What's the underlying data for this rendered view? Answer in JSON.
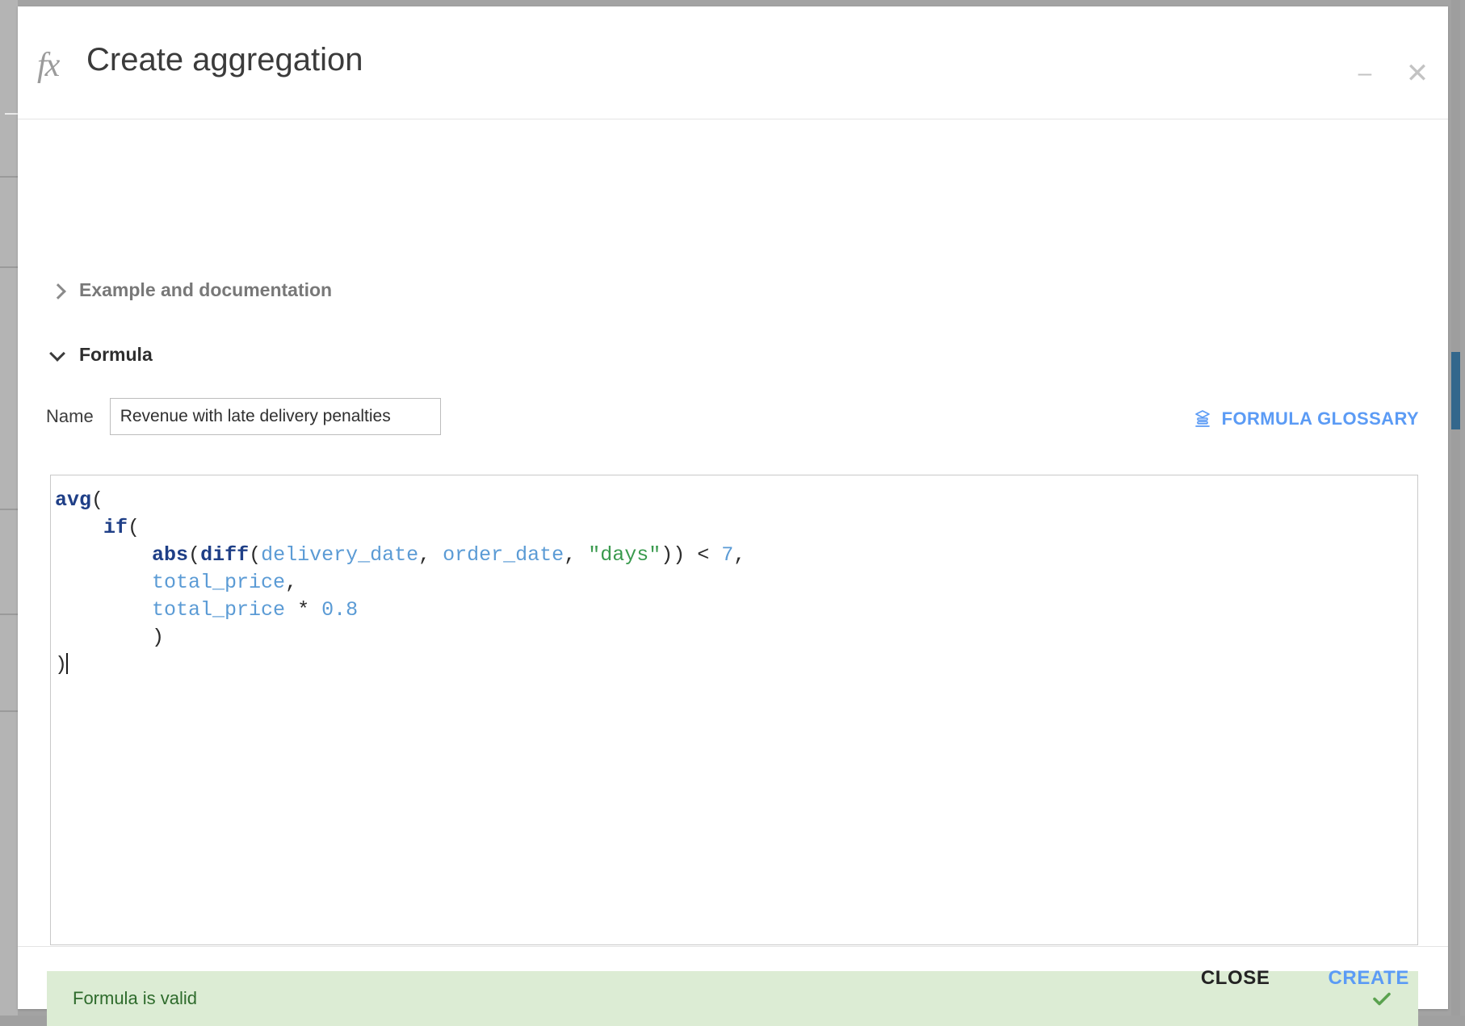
{
  "window": {
    "title": "Create aggregation",
    "fx_icon": "fx-icon",
    "minimize_label": "–",
    "close_label": "✕"
  },
  "sections": [
    {
      "key": "example",
      "label": "Example and documentation",
      "expanded": false,
      "chevron": "chevron-right-icon"
    },
    {
      "key": "formula",
      "label": "Formula",
      "expanded": true,
      "chevron": "chevron-down-icon"
    }
  ],
  "name_field": {
    "label": "Name",
    "value": "Revenue with late delivery penalties",
    "placeholder": "Name"
  },
  "glossary": {
    "label": "FORMULA GLOSSARY",
    "icon": "book-icon"
  },
  "editor": {
    "lines": [
      [
        {
          "t": "avg",
          "c": "tok-fn"
        },
        {
          "t": "(",
          "c": "tok-punc"
        }
      ],
      [
        {
          "t": "    ",
          "c": "tok-punc"
        },
        {
          "t": "if",
          "c": "tok-fn"
        },
        {
          "t": "(",
          "c": "tok-punc"
        }
      ],
      [
        {
          "t": "        ",
          "c": "tok-punc"
        },
        {
          "t": "abs",
          "c": "tok-fn"
        },
        {
          "t": "(",
          "c": "tok-punc"
        },
        {
          "t": "diff",
          "c": "tok-fn"
        },
        {
          "t": "(",
          "c": "tok-punc"
        },
        {
          "t": "delivery_date",
          "c": "tok-id"
        },
        {
          "t": ", ",
          "c": "tok-punc"
        },
        {
          "t": "order_date",
          "c": "tok-id"
        },
        {
          "t": ", ",
          "c": "tok-punc"
        },
        {
          "t": "\"days\"",
          "c": "tok-str"
        },
        {
          "t": "))",
          "c": "tok-punc"
        },
        {
          "t": " < ",
          "c": "tok-op"
        },
        {
          "t": "7",
          "c": "tok-num"
        },
        {
          "t": ",",
          "c": "tok-punc"
        }
      ],
      [
        {
          "t": "        ",
          "c": "tok-punc"
        },
        {
          "t": "total_price",
          "c": "tok-id"
        },
        {
          "t": ",",
          "c": "tok-punc"
        }
      ],
      [
        {
          "t": "        ",
          "c": "tok-punc"
        },
        {
          "t": "total_price",
          "c": "tok-id"
        },
        {
          "t": " * ",
          "c": "tok-op"
        },
        {
          "t": "0.8",
          "c": "tok-num"
        }
      ],
      [
        {
          "t": "        ",
          "c": "tok-punc"
        },
        {
          "t": ")",
          "c": "tok-punc"
        }
      ],
      [
        {
          "t": ")",
          "c": "tok-punc"
        }
      ]
    ],
    "plain_text": "avg(\n    if(\n        abs(diff(delivery_date, order_date, \"days\")) < 7,\n        total_price,\n        total_price * 0.8\n        )\n)",
    "caret_visible": true
  },
  "validation": {
    "message": "Formula is valid",
    "status": "valid",
    "icon": "check-icon",
    "background_color": "#dcecd4",
    "text_color": "#2e6b2c",
    "icon_color": "#5aa24f"
  },
  "footer": {
    "close_label": "CLOSE",
    "create_label": "CREATE"
  },
  "colors": {
    "accent_blue": "#5b9bf5",
    "function_blue": "#1f3f87",
    "identifier_blue": "#5b9bd5",
    "string_green": "#3a9a4e",
    "scrollbar_thumb": "#33678c"
  }
}
